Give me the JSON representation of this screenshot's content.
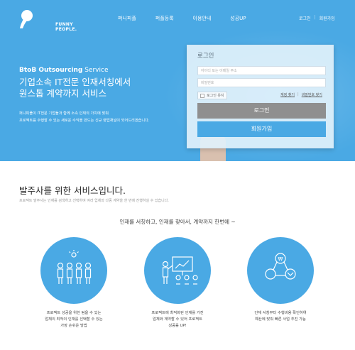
{
  "header": {
    "logo_line1": "FUNNY",
    "logo_line2": "PEOPLE.",
    "nav": [
      "퍼니피플",
      "퍼플등록",
      "이용안내",
      "성공UP"
    ],
    "login_link": "로그인",
    "join_link": "회원가입"
  },
  "hero": {
    "eyebrow_bold": "BtoB Outsourcing",
    "eyebrow_rest": " Service",
    "title_line1": "기업소속 IT전문 인재서칭에서",
    "title_line2": "원스톱 계약까지 서비스",
    "desc_line1": "퍼니피플이 IT전문 기업들과 함께 소속 인재의 가치에 맞춰",
    "desc_line2": "프로젝트를 수행할 수 있는 새로운 수익을 만드는 신규 영업채널이 되어드리겠습니다."
  },
  "login": {
    "title": "로그인",
    "id_placeholder": "아이디 또는 이메일 주소",
    "pw_placeholder": "비밀번호",
    "keep_label": "로그인 유지",
    "find_id": "계정 찾기",
    "find_pw": "비밀번호 찾기",
    "login_button": "로그인",
    "join_button": "회원가입"
  },
  "services": {
    "title": "발주사를 위한 서비스입니다.",
    "description": "프로젝트 발주사는 인재를 검색하고 선택하여 여러 업체와 다중 계약을 한 번에 진행하실 수 있습니다.",
    "subtitle": "인재를 서칭하고, 인재를 찾아서, 계약까지 한번에 ~",
    "features": [
      {
        "icon": "team-search-icon",
        "line1": "프로젝트 성공을 위한 팀을 수 있는",
        "line2": "업체의 최적의 인재를 선택할 수 있는",
        "line3": "가장 손쉬운 방법"
      },
      {
        "icon": "presentation-icon",
        "line1": "프로젝트에 최적화된 인재를 가진",
        "line2": "업체와 계약할 수 있어 프로젝트",
        "line3": "성공률 UP!"
      },
      {
        "icon": "contract-flow-icon",
        "line1": "인재 서칭부터 수행비용 확인하여",
        "line2": "예산에 맞춰 빠른 사업 추진 가능",
        "line3": ""
      }
    ]
  },
  "colors": {
    "brand_blue": "#4aa9e4",
    "login_gray": "#8f8f8f"
  }
}
